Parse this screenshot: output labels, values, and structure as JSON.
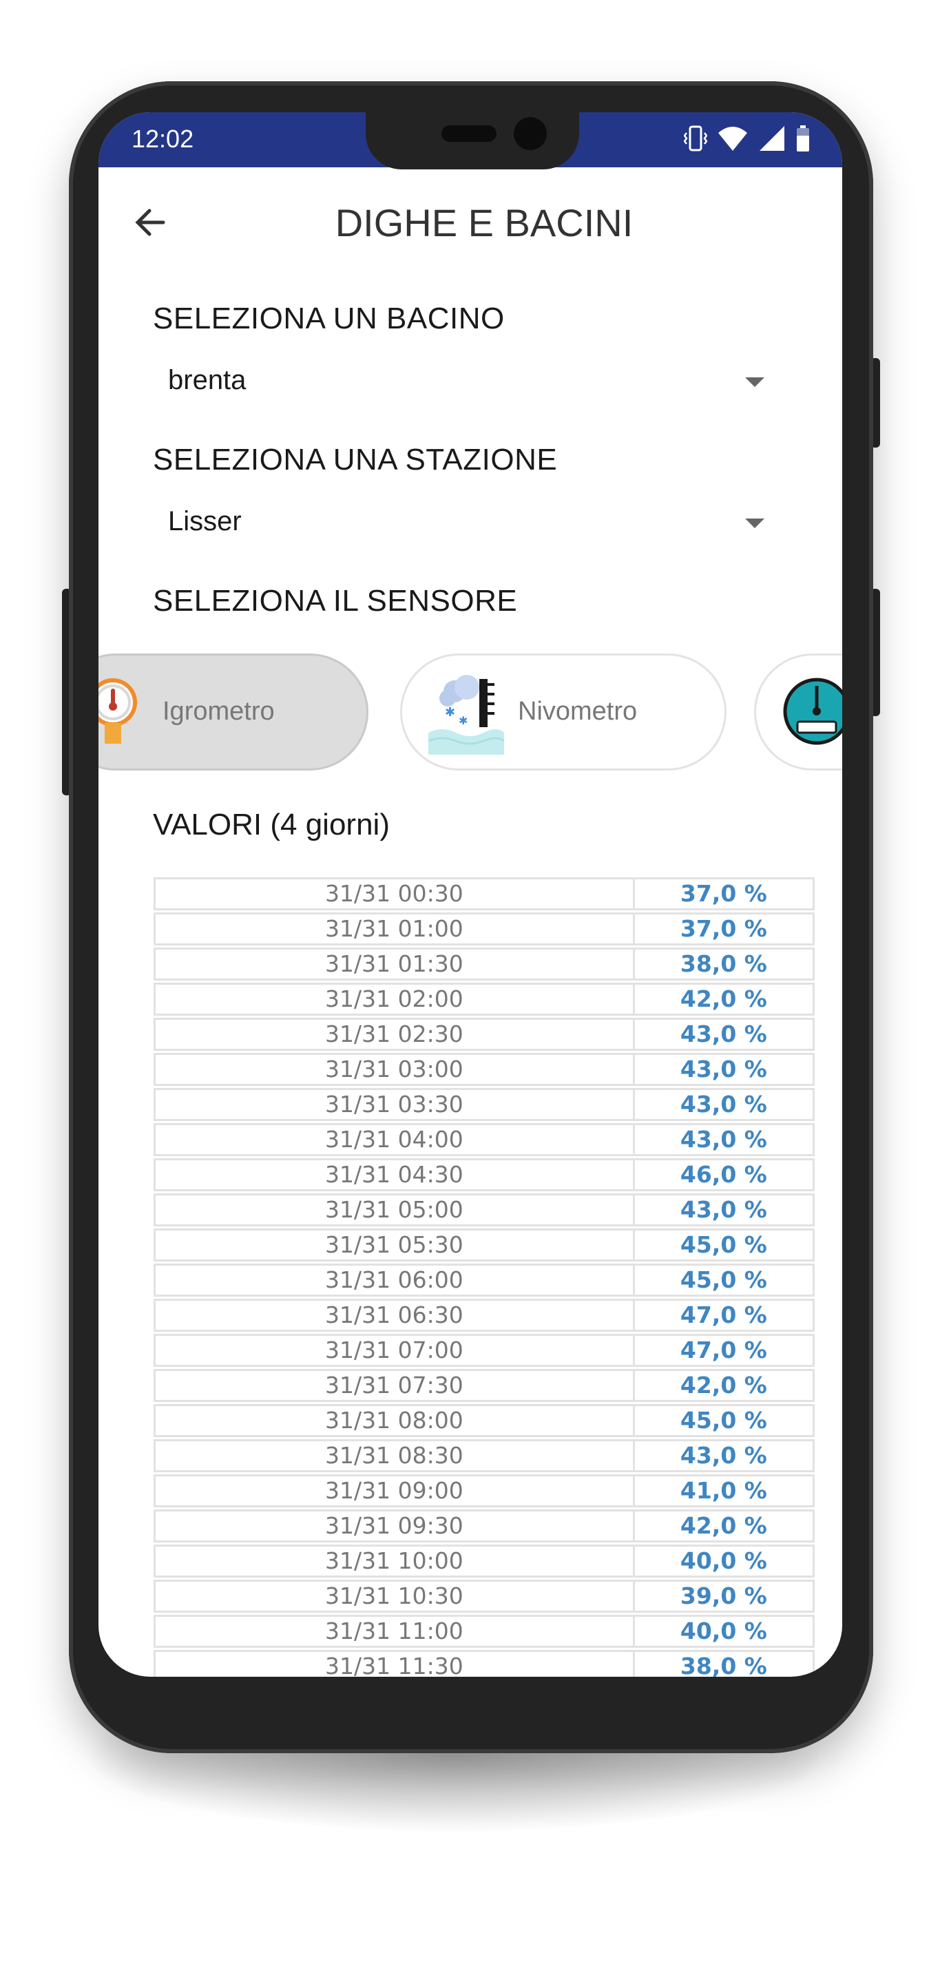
{
  "status_bar": {
    "time": "12:02"
  },
  "app_bar": {
    "title": "DIGHE E BACINI"
  },
  "basin": {
    "label": "SELEZIONA UN BACINO",
    "selected": "brenta"
  },
  "station": {
    "label": "SELEZIONA UNA STAZIONE",
    "selected": "Lisser"
  },
  "sensor": {
    "label": "SELEZIONA IL SENSORE",
    "chips": [
      {
        "label": "Igrometro",
        "icon": "hygrometer-icon",
        "selected": true
      },
      {
        "label": "Nivometro",
        "icon": "snow-gauge-icon",
        "selected": false
      },
      {
        "label": "",
        "icon": "gauge-icon",
        "selected": false
      }
    ]
  },
  "values": {
    "title": "VALORI (4 giorni)",
    "rows": [
      {
        "time": "31/31 00:30",
        "value": "37,0 %"
      },
      {
        "time": "31/31 01:00",
        "value": "37,0 %"
      },
      {
        "time": "31/31 01:30",
        "value": "38,0 %"
      },
      {
        "time": "31/31 02:00",
        "value": "42,0 %"
      },
      {
        "time": "31/31 02:30",
        "value": "43,0 %"
      },
      {
        "time": "31/31 03:00",
        "value": "43,0 %"
      },
      {
        "time": "31/31 03:30",
        "value": "43,0 %"
      },
      {
        "time": "31/31 04:00",
        "value": "43,0 %"
      },
      {
        "time": "31/31 04:30",
        "value": "46,0 %"
      },
      {
        "time": "31/31 05:00",
        "value": "43,0 %"
      },
      {
        "time": "31/31 05:30",
        "value": "45,0 %"
      },
      {
        "time": "31/31 06:00",
        "value": "45,0 %"
      },
      {
        "time": "31/31 06:30",
        "value": "47,0 %"
      },
      {
        "time": "31/31 07:00",
        "value": "47,0 %"
      },
      {
        "time": "31/31 07:30",
        "value": "42,0 %"
      },
      {
        "time": "31/31 08:00",
        "value": "45,0 %"
      },
      {
        "time": "31/31 08:30",
        "value": "43,0 %"
      },
      {
        "time": "31/31 09:00",
        "value": "41,0 %"
      },
      {
        "time": "31/31 09:30",
        "value": "42,0 %"
      },
      {
        "time": "31/31 10:00",
        "value": "40,0 %"
      },
      {
        "time": "31/31 10:30",
        "value": "39,0 %"
      },
      {
        "time": "31/31 11:00",
        "value": "40,0 %"
      },
      {
        "time": "31/31 11:30",
        "value": "38,0 %"
      }
    ]
  },
  "colors": {
    "status_bar": "#243687",
    "value_text": "#3f86c2",
    "time_text": "#777777",
    "chip_selected": "#dddddd"
  }
}
